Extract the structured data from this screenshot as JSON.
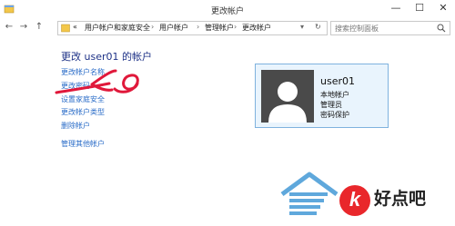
{
  "window": {
    "title": "更改帐户",
    "min": "—",
    "max": "☐",
    "close": "✕"
  },
  "nav": {
    "back": "←",
    "forward": "→",
    "up": "↑",
    "prefix": "«"
  },
  "breadcrumbs": [
    {
      "label": "用户帐户和家庭安全"
    },
    {
      "label": "用户帐户"
    },
    {
      "label": "管理帐户"
    },
    {
      "label": "更改帐户"
    }
  ],
  "breadcrumb_sep": "›",
  "search": {
    "placeholder": "搜索控制面板"
  },
  "page": {
    "heading": "更改 user01 的帐户"
  },
  "links": {
    "change_name": "更改帐户名称",
    "change_password": "更改密码",
    "family_safety": "设置家庭安全",
    "change_type": "更改帐户类型",
    "delete_account": "删除帐户",
    "manage_other": "管理其他帐户"
  },
  "account_card": {
    "username": "user01",
    "line1": "本地帐户",
    "line2": "管理员",
    "line3": "密码保护"
  },
  "annotation": {
    "color": "#e0183a"
  },
  "watermark": {
    "text": "好点吧",
    "circle_glyph": "k"
  },
  "colors": {
    "link": "#2a6cc8",
    "heading": "#1e3287",
    "card_border": "#7fb2de",
    "card_bg": "#e9f4fd"
  }
}
